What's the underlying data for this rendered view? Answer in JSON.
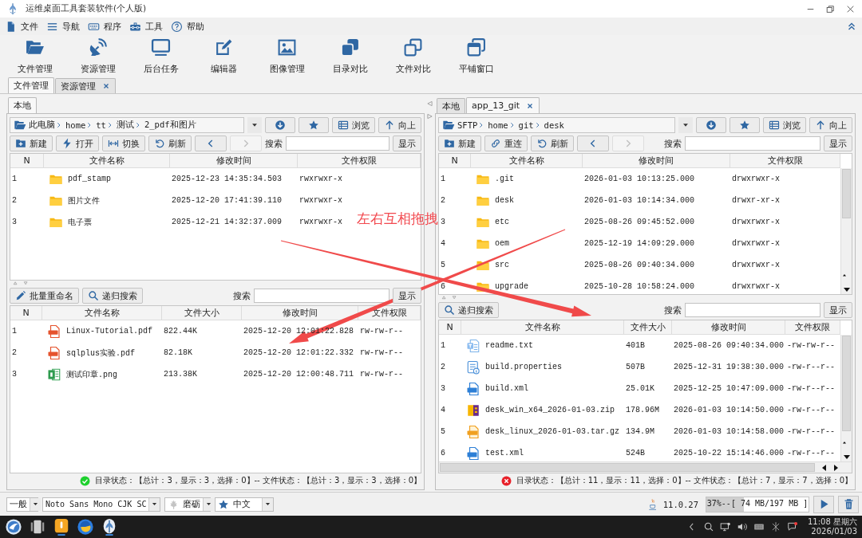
{
  "window": {
    "title": "运维桌面工具套装软件(个人版)"
  },
  "menu": [
    {
      "label": "文件"
    },
    {
      "label": "导航"
    },
    {
      "label": "程序"
    },
    {
      "label": "工具"
    },
    {
      "label": "帮助"
    }
  ],
  "toolbar": [
    {
      "label": "文件管理"
    },
    {
      "label": "资源管理"
    },
    {
      "label": "后台任务"
    },
    {
      "label": "编辑器"
    },
    {
      "label": "图像管理"
    },
    {
      "label": "目录对比"
    },
    {
      "label": "文件对比"
    },
    {
      "label": "平铺窗口"
    }
  ],
  "tabs": [
    {
      "label": "文件管理",
      "selected": true,
      "closable": false
    },
    {
      "label": "资源管理",
      "selected": false,
      "closable": true
    }
  ],
  "panes": [
    {
      "tabs": [
        {
          "label": "本地",
          "selected": true,
          "closable": false
        }
      ],
      "path": {
        "root": "此电脑",
        "segments": [
          "home",
          "tt",
          "测试",
          "2_pdf和图片"
        ]
      },
      "path_buttons": [
        {
          "label": "浏览"
        },
        {
          "label": "向上"
        }
      ],
      "actions": [
        {
          "label": "新建",
          "kind": "new"
        },
        {
          "label": "打开",
          "kind": "open"
        },
        {
          "label": "切换",
          "kind": "switch"
        },
        {
          "label": "刷新",
          "kind": "refresh"
        }
      ],
      "nav": [
        {
          "kind": "back",
          "disabled": false
        },
        {
          "kind": "forward",
          "disabled": true
        }
      ],
      "search_label": "搜索",
      "show_button": "显示",
      "dirs": {
        "columns": [
          "N",
          "文件名称",
          "修改时间",
          "文件权限"
        ],
        "rows": [
          {
            "n": "1",
            "name": "pdf_stamp",
            "kind": "folder",
            "modified": "2025-12-23 14:35:34.503",
            "permissions": "rwxrwxr-x"
          },
          {
            "n": "2",
            "name": "图片文件",
            "kind": "folder",
            "modified": "2025-12-20 17:41:39.110",
            "permissions": "rwxrwxr-x"
          },
          {
            "n": "3",
            "name": "电子票",
            "kind": "folder",
            "modified": "2025-12-21 14:32:37.009",
            "permissions": "rwxrwxr-x"
          }
        ]
      },
      "tools": [
        {
          "label": "批量重命名",
          "kind": "rename"
        },
        {
          "label": "递归搜索",
          "kind": "search"
        }
      ],
      "file_search_label": "搜索",
      "file_show_button": "显示",
      "files": {
        "columns": [
          "N",
          "文件名称",
          "文件大小",
          "修改时间",
          "文件权限"
        ],
        "rows": [
          {
            "n": "1",
            "name": "Linux-Tutorial.pdf",
            "kind": "pdf",
            "size": "822.44K",
            "modified": "2025-12-20 12:01:22.828",
            "permissions": "rw-rw-r--"
          },
          {
            "n": "2",
            "name": "sqlplus实验.pdf",
            "kind": "pdf",
            "size": "82.18K",
            "modified": "2025-12-20 12:01:22.332",
            "permissions": "rw-rw-r--"
          },
          {
            "n": "3",
            "name": "测试印章.png",
            "kind": "png",
            "size": "213.38K",
            "modified": "2025-12-20 12:00:48.711",
            "permissions": "rw-rw-r--"
          }
        ]
      },
      "status": {
        "ok": true,
        "text": "目录状态：【总计：3，显示：3，选择：0】-- 文件状态：【总计：3，显示：3，选择：0】"
      }
    },
    {
      "tabs": [
        {
          "label": "本地",
          "selected": false,
          "closable": false
        },
        {
          "label": "app_13_git",
          "selected": true,
          "closable": true
        }
      ],
      "path": {
        "root": "SFTP",
        "segments": [
          "home",
          "git",
          "desk"
        ]
      },
      "path_buttons": [
        {
          "label": "浏览"
        },
        {
          "label": "向上"
        }
      ],
      "actions": [
        {
          "label": "新建",
          "kind": "new"
        },
        {
          "label": "重连",
          "kind": "reconnect"
        },
        {
          "label": "刷新",
          "kind": "refresh"
        }
      ],
      "nav": [
        {
          "kind": "back",
          "disabled": false
        },
        {
          "kind": "forward",
          "disabled": true
        }
      ],
      "search_label": "搜索",
      "show_button": "显示",
      "dirs": {
        "columns": [
          "N",
          "文件名称",
          "修改时间",
          "文件权限"
        ],
        "rows": [
          {
            "n": "1",
            "name": ".git",
            "kind": "folder",
            "modified": "2026-01-03 10:13:25.000",
            "permissions": "drwxrwxr-x"
          },
          {
            "n": "2",
            "name": "desk",
            "kind": "folder",
            "modified": "2026-01-03 10:14:34.000",
            "permissions": "drwxr-xr-x"
          },
          {
            "n": "3",
            "name": "etc",
            "kind": "folder",
            "modified": "2025-08-26 09:45:52.000",
            "permissions": "drwxrwxr-x"
          },
          {
            "n": "4",
            "name": "oem",
            "kind": "folder",
            "modified": "2025-12-19 14:09:29.000",
            "permissions": "drwxrwxr-x"
          },
          {
            "n": "5",
            "name": "src",
            "kind": "folder",
            "modified": "2025-08-26 09:40:34.000",
            "permissions": "drwxrwxr-x"
          },
          {
            "n": "6",
            "name": "upgrade",
            "kind": "folder",
            "modified": "2025-10-28 10:58:24.000",
            "permissions": "drwxrwxr-x"
          }
        ]
      },
      "tools": [
        {
          "label": "递归搜索",
          "kind": "search"
        }
      ],
      "file_search_label": "搜索",
      "file_show_button": "显示",
      "files": {
        "columns": [
          "N",
          "文件名称",
          "文件大小",
          "修改时间",
          "文件权限"
        ],
        "rows": [
          {
            "n": "1",
            "name": "readme.txt",
            "kind": "txt",
            "size": "401B",
            "modified": "2025-08-26 09:40:34.000",
            "permissions": "-rw-rw-r--"
          },
          {
            "n": "2",
            "name": "build.properties",
            "kind": "properties",
            "size": "507B",
            "modified": "2025-12-31 19:38:30.000",
            "permissions": "-rw-r--r--"
          },
          {
            "n": "3",
            "name": "build.xml",
            "kind": "xml",
            "size": "25.01K",
            "modified": "2025-12-25 10:47:09.000",
            "permissions": "-rw-r--r--"
          },
          {
            "n": "4",
            "name": "desk_win_x64_2026-01-03.zip",
            "kind": "zip",
            "size": "178.96M",
            "modified": "2026-01-03 10:14:50.000",
            "permissions": "-rw-r--r--"
          },
          {
            "n": "5",
            "name": "desk_linux_2026-01-03.tar.gz",
            "kind": "gzip",
            "size": "134.9M",
            "modified": "2026-01-03 10:14:58.000",
            "permissions": "-rw-r--r--"
          },
          {
            "n": "6",
            "name": "test.xml",
            "kind": "xml",
            "size": "524B",
            "modified": "2025-10-22 15:14:46.000",
            "permissions": "-rw-r--r--"
          }
        ]
      },
      "status": {
        "ok": false,
        "text": "目录状态：【总计：11，显示：11，选择：0】-- 文件状态：【总计：7，显示：7，选择：0】"
      }
    }
  ],
  "bottom": {
    "selectors": [
      {
        "value": "一般",
        "kind": "plain"
      },
      {
        "value": "Noto Sans Mono CJK SC",
        "kind": "plain"
      },
      {
        "value": "磨砺",
        "kind": "theme"
      },
      {
        "value": "中文",
        "kind": "language"
      }
    ],
    "java_version": "11.0.27",
    "memory": {
      "text": "37%--[ 74 MB/197 MB ]",
      "level": 0.37
    }
  },
  "taskbar": {
    "time": "11:08 星期六",
    "date": "2026/01/03"
  },
  "annotation": {
    "text": "左右互相拖拽"
  }
}
